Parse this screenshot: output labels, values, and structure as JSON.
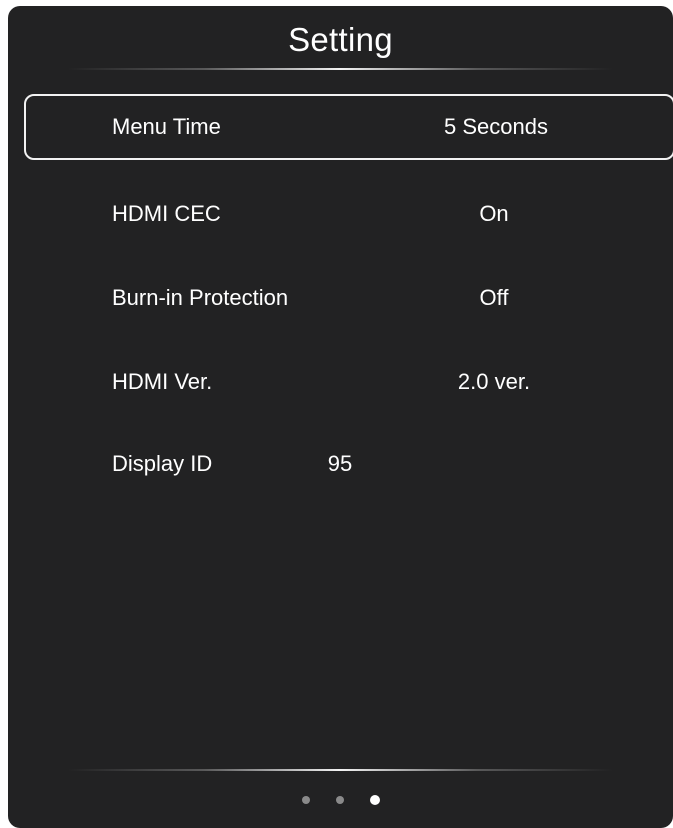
{
  "title": "Setting",
  "items": [
    {
      "label": "Menu Time",
      "value": "5 Seconds",
      "selected": true
    },
    {
      "label": "HDMI CEC",
      "value": "On",
      "selected": false
    },
    {
      "label": "Burn-in Protection",
      "value": "Off",
      "selected": false
    },
    {
      "label": "HDMI Ver.",
      "value": "2.0 ver.",
      "selected": false
    },
    {
      "label": "Display ID",
      "value": "95",
      "selected": false
    }
  ],
  "pagination": {
    "total": 3,
    "current": 3
  }
}
